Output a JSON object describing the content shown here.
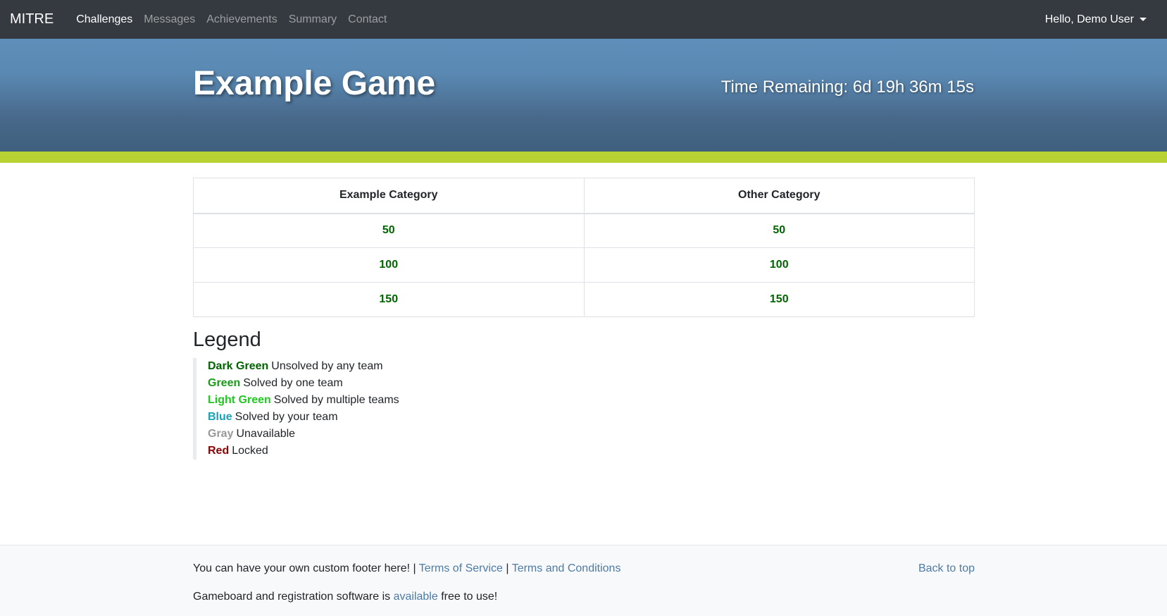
{
  "navbar": {
    "brand": "MITRE",
    "links": [
      "Challenges",
      "Messages",
      "Achievements",
      "Summary",
      "Contact"
    ],
    "user_greeting": "Hello, Demo User"
  },
  "hero": {
    "title": "Example Game",
    "timer": "Time Remaining: 6d 19h 36m 15s"
  },
  "board": {
    "columns": [
      "Example Category",
      "Other Category"
    ],
    "rows": [
      [
        "50",
        "50"
      ],
      [
        "100",
        "100"
      ],
      [
        "150",
        "150"
      ]
    ]
  },
  "legend": {
    "title": "Legend",
    "items": [
      {
        "key": "Dark Green",
        "desc": "Unsolved by any team",
        "color": "#006400"
      },
      {
        "key": "Green",
        "desc": "Solved by one team",
        "color": "#1a9a1a"
      },
      {
        "key": "Light Green",
        "desc": "Solved by multiple teams",
        "color": "#1ec81e"
      },
      {
        "key": "Blue",
        "desc": "Solved by your team",
        "color": "#17a2b8"
      },
      {
        "key": "Gray",
        "desc": "Unavailable",
        "color": "#999999"
      },
      {
        "key": "Red",
        "desc": "Locked",
        "color": "#8b0000"
      }
    ]
  },
  "footer": {
    "custom_text": "You can have your own custom footer here! |",
    "separator": "|",
    "terms_service": "Terms of Service",
    "terms_conditions": "Terms and Conditions",
    "back_to_top": "Back to top",
    "software_prefix": "Gameboard and registration software is",
    "software_link": "available",
    "software_suffix": "free to use!"
  },
  "colors": {
    "navbar_bg": "#343a40",
    "hero_top": "#5e8fba",
    "hero_bottom": "#3f5f7d",
    "accent": "#b9d233",
    "link": "#4e7aa8",
    "unsolved": "#006400"
  }
}
